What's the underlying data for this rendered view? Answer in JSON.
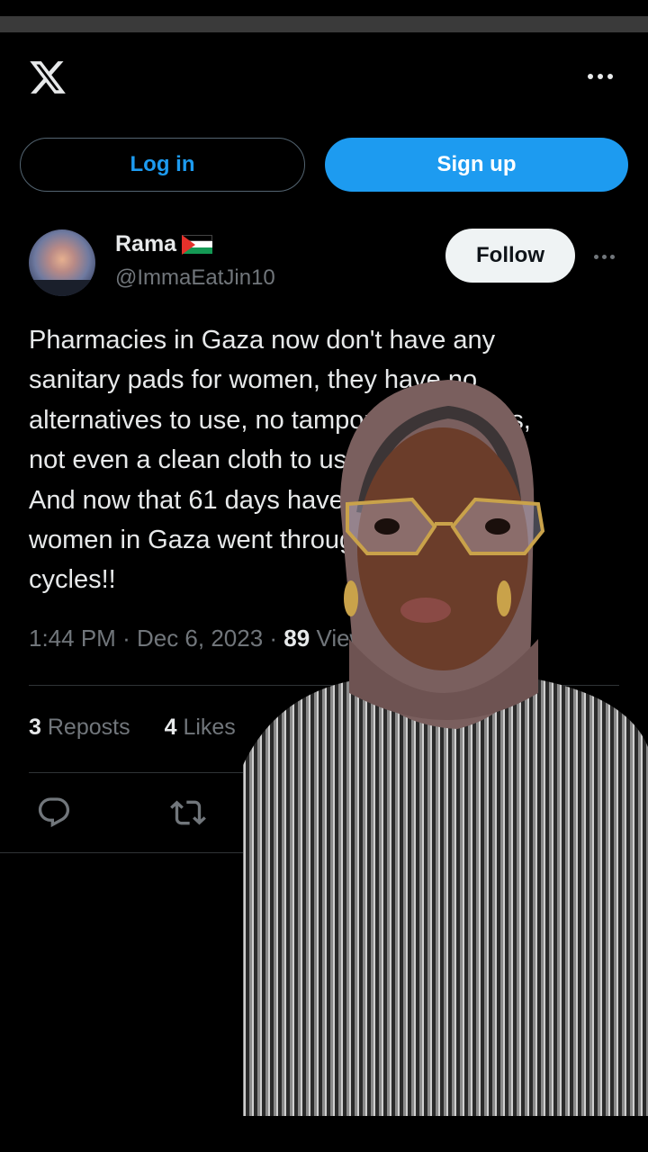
{
  "header": {
    "logo_icon": "x-logo-icon",
    "more_icon": "more-horizontal-icon"
  },
  "auth": {
    "login_label": "Log in",
    "signup_label": "Sign up"
  },
  "post": {
    "author": {
      "display_name": "Rama",
      "flag_icon": "palestine-flag-icon",
      "handle": "@ImmaEatJin10"
    },
    "follow_label": "Follow",
    "text": "Pharmacies in Gaza now don't have any\nsanitary pads for women, they have no\nalternatives to use, no tampons, no tissues,\nnot even a clean cloth to use.\nAnd now that 61 days have passed, each\nwomen in Gaza went through about 2\ncycles!!",
    "time": "1:44 PM",
    "date": "Dec 6, 2023",
    "views_count": "89",
    "views_label": "Views",
    "reposts_count": "3",
    "reposts_label": "Reposts",
    "likes_count": "4",
    "likes_label": "Likes",
    "actions": {
      "reply_icon": "reply-icon",
      "repost_icon": "repost-icon"
    }
  },
  "colors": {
    "background": "#000000",
    "accent": "#1d9bf0",
    "text_primary": "#e7e9ea",
    "text_secondary": "#71767b",
    "follow_bg": "#eff3f4"
  }
}
